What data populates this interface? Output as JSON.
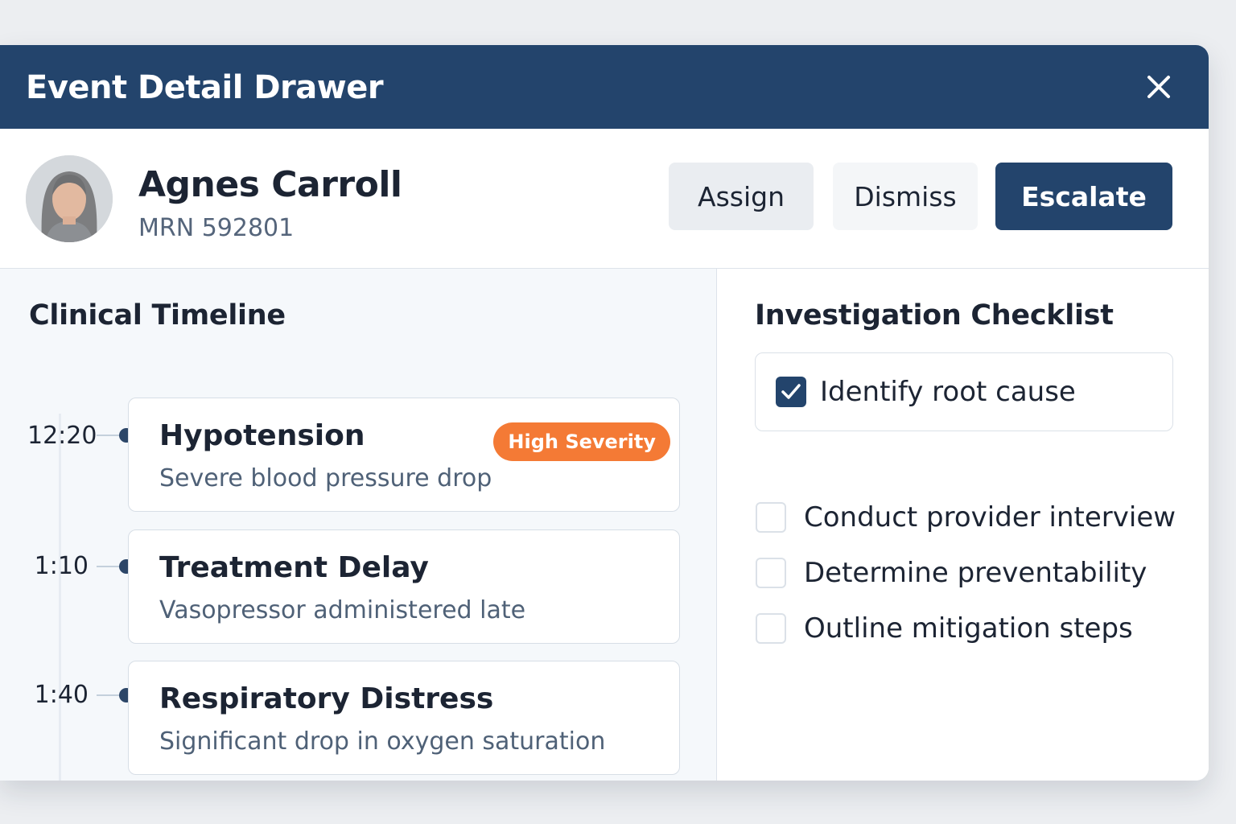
{
  "drawer": {
    "title": "Event Detail Drawer",
    "close_icon": "close-icon"
  },
  "patient": {
    "name": "Agnes Carroll",
    "mrn": "MRN 592801",
    "avatar_icon": "avatar"
  },
  "actions": {
    "assign": "Assign",
    "dismiss": "Dismiss",
    "escalate": "Escalate"
  },
  "timeline": {
    "title": "Clinical Timeline",
    "events": [
      {
        "time": "12:20",
        "title": "Hypotension",
        "description": "Severe blood pressure drop",
        "badge": "High Severity"
      },
      {
        "time": "1:10",
        "title": "Treatment Delay",
        "description": "Vasopressor administered late"
      },
      {
        "time": "1:40",
        "title": "Respiratory Distress",
        "description": "Significant drop in oxygen saturation"
      }
    ]
  },
  "checklist": {
    "title": "Investigation Checklist",
    "items": [
      {
        "label": "Identify root cause",
        "checked": true
      },
      {
        "label": "Conduct provider interview",
        "checked": false
      },
      {
        "label": "Determine preventability",
        "checked": false
      },
      {
        "label": "Outline mitigation steps",
        "checked": false
      }
    ]
  },
  "colors": {
    "header": "#23446c",
    "badge_high": "#f47a35",
    "checkbox_checked": "#23446c"
  }
}
